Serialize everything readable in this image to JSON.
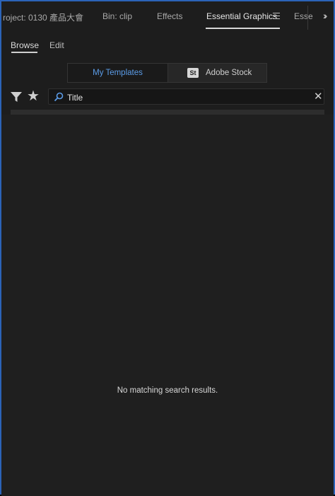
{
  "tabs": [
    {
      "label": "roject: 0130 產品大會"
    },
    {
      "label": "Bin: clip"
    },
    {
      "label": "Effects"
    },
    {
      "label": "Essential Graphics",
      "active": true
    },
    {
      "label": "Esse"
    }
  ],
  "subtabs": {
    "browse": "Browse",
    "edit": "Edit"
  },
  "segmented": {
    "my_templates": "My Templates",
    "stock_badge": "St",
    "adobe_stock": "Adobe Stock"
  },
  "search": {
    "value": "Title"
  },
  "empty_message": "No matching search results.",
  "icons": {
    "menu": "hamburger-icon",
    "overflow": "double-chevron-right-icon",
    "filter": "funnel-icon",
    "favorites": "star-icon",
    "search": "magnifier-icon",
    "clear": "close-icon"
  },
  "colors": {
    "accent": "#5b9ce8",
    "panel_border": "#2b63b8",
    "background": "#1d1d1d"
  }
}
